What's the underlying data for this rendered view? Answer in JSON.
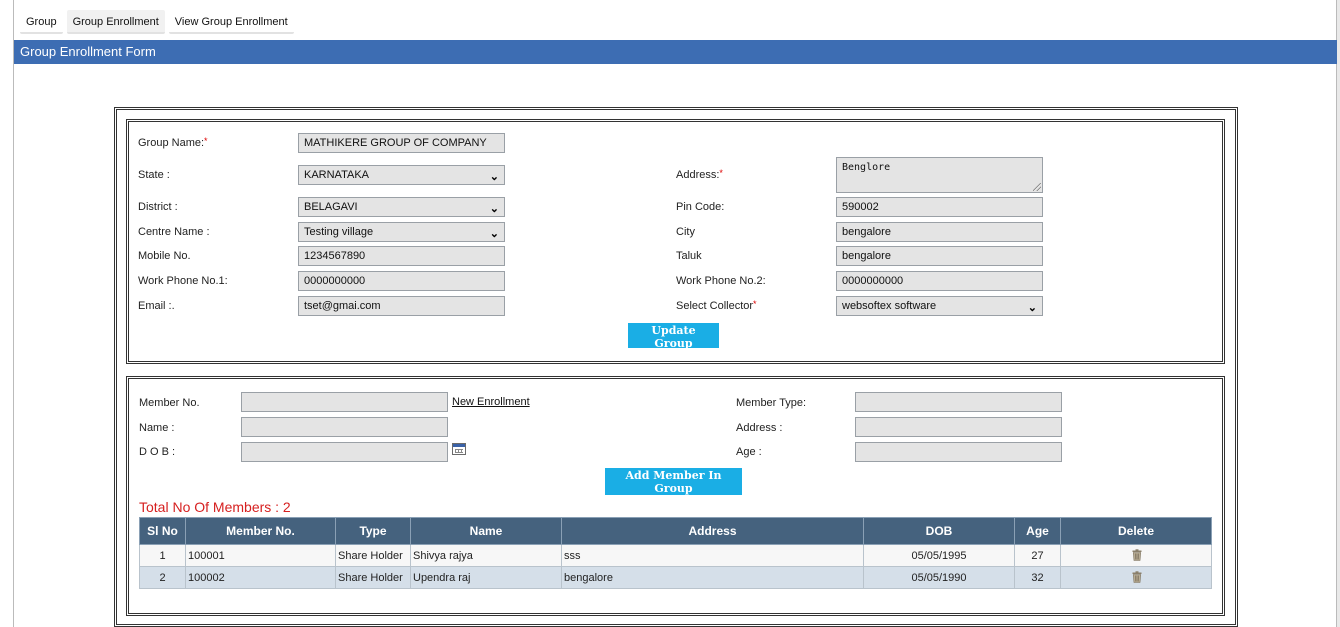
{
  "nav": {
    "items": [
      {
        "label": "Group",
        "active": false
      },
      {
        "label": "Group Enrollment",
        "active": true
      },
      {
        "label": "View Group Enrollment",
        "active": false
      }
    ]
  },
  "page_title": "Group Enrollment Form",
  "group_form": {
    "group_name": {
      "label": "Group Name:",
      "value": "MATHIKERE GROUP OF COMPANY"
    },
    "state": {
      "label": "State :",
      "value": "KARNATAKA"
    },
    "district": {
      "label": "District :",
      "value": "BELAGAVI"
    },
    "centre_name": {
      "label": "Centre Name :",
      "value": "Testing village"
    },
    "mobile": {
      "label": "Mobile No.",
      "value": "1234567890"
    },
    "work_phone_1": {
      "label": "Work Phone No.1:",
      "value": "0000000000"
    },
    "email": {
      "label": "Email :.",
      "value": "tset@gmai.com"
    },
    "address": {
      "label": "Address:",
      "value": "Benglore"
    },
    "pin_code": {
      "label": "Pin Code:",
      "value": "590002"
    },
    "city": {
      "label": "City",
      "value": "bengalore"
    },
    "taluk": {
      "label": "Taluk",
      "value": "bengalore"
    },
    "work_phone_2": {
      "label": "Work Phone No.2:",
      "value": "0000000000"
    },
    "collector": {
      "label": "Select Collector",
      "value": "websoftex software"
    },
    "required_mark": "*",
    "update_button": "Update Group"
  },
  "member_form": {
    "member_no": {
      "label": "Member No.",
      "value": ""
    },
    "new_enrollment_link": "New Enrollment",
    "name": {
      "label": "Name :",
      "value": ""
    },
    "dob": {
      "label": "D O B :",
      "value": ""
    },
    "member_type": {
      "label": "Member Type:",
      "value": ""
    },
    "address": {
      "label": "Address :",
      "value": ""
    },
    "age": {
      "label": "Age :",
      "value": ""
    },
    "add_button": "Add Member In Group"
  },
  "members": {
    "total_label": "Total No Of Members : 2",
    "columns": [
      "Sl No",
      "Member No.",
      "Type",
      "Name",
      "Address",
      "DOB",
      "Age",
      "Delete"
    ],
    "rows": [
      {
        "sl": "1",
        "member_no": "100001",
        "type": "Share Holder",
        "name": "Shivya rajya",
        "address": "sss",
        "dob": "05/05/1995",
        "age": "27"
      },
      {
        "sl": "2",
        "member_no": "100002",
        "type": "Share Holder",
        "name": "Upendra raj",
        "address": "bengalore",
        "dob": "05/05/1990",
        "age": "32"
      }
    ]
  },
  "colors": {
    "title_bar": "#3d6db3",
    "button": "#1aaee5",
    "table_header": "#45627e",
    "total_text": "#d62020"
  }
}
